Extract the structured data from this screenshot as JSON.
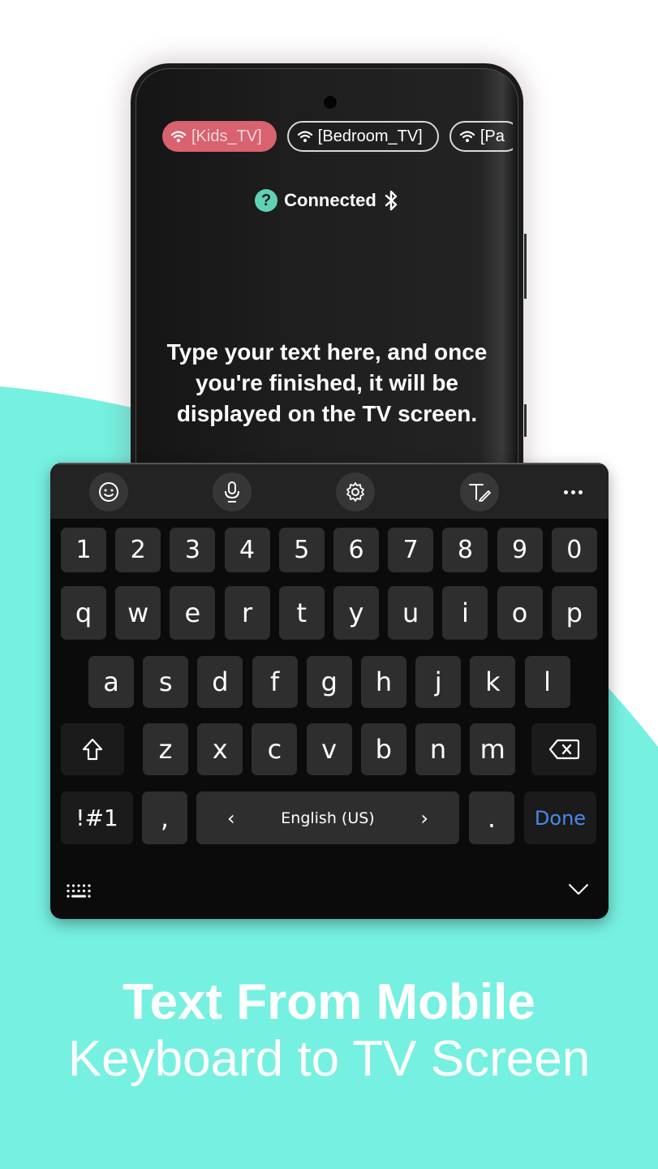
{
  "colors": {
    "teal_background": "#76f0e0",
    "active_chip": "#d8626e",
    "help_icon": "#5fd2b6",
    "done_blue": "#4a8ae8",
    "key_bg": "#2e2e2e",
    "keyboard_bg": "#0b0b0b"
  },
  "phone": {
    "tv_chips": [
      {
        "label": "[Kids_TV]",
        "active": true,
        "icon": "wifi-icon"
      },
      {
        "label": "[Bedroom_TV]",
        "active": false,
        "icon": "wifi-icon"
      },
      {
        "label": "[Pa",
        "active": false,
        "icon": "wifi-icon"
      }
    ],
    "status": {
      "help_icon_glyph": "?",
      "text": "Connected",
      "icon": "bluetooth-icon"
    },
    "instructions": "Type your text here, and once you're finished, it will be displayed on the TV screen."
  },
  "keyboard": {
    "toolbar": [
      {
        "name": "emoji-icon"
      },
      {
        "name": "microphone-icon"
      },
      {
        "name": "settings-icon"
      },
      {
        "name": "handwriting-icon"
      },
      {
        "name": "more-icon"
      }
    ],
    "number_row": [
      "1",
      "2",
      "3",
      "4",
      "5",
      "6",
      "7",
      "8",
      "9",
      "0"
    ],
    "row1": [
      "q",
      "w",
      "e",
      "r",
      "t",
      "y",
      "u",
      "i",
      "o",
      "p"
    ],
    "row2": [
      "a",
      "s",
      "d",
      "f",
      "g",
      "h",
      "j",
      "k",
      "l"
    ],
    "row3": [
      "z",
      "x",
      "c",
      "v",
      "b",
      "n",
      "m"
    ],
    "bottom": {
      "symbols": "!#1",
      "comma": ",",
      "language": "English (US)",
      "lang_prev": "‹",
      "lang_next": "›",
      "period": ".",
      "done": "Done"
    }
  },
  "headline": {
    "line1": "Text From Mobile",
    "line2": "Keyboard to TV Screen"
  }
}
